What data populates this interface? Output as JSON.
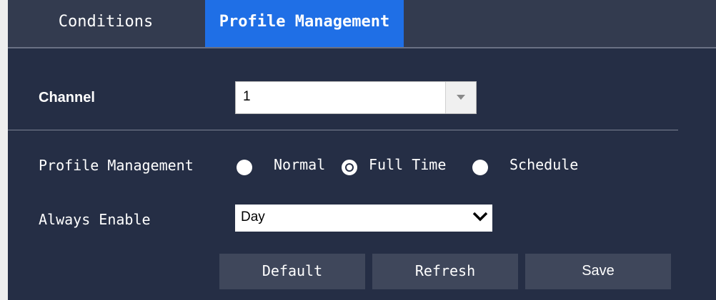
{
  "tabs": {
    "conditions": "Conditions",
    "profile_management": "Profile Management"
  },
  "channel": {
    "label": "Channel",
    "value": "1"
  },
  "profile_management": {
    "label": "Profile Management",
    "options": [
      "Normal",
      "Full Time",
      "Schedule"
    ],
    "selected": "Full Time"
  },
  "always_enable": {
    "label": "Always Enable",
    "value": "Day"
  },
  "buttons": {
    "default": "Default",
    "refresh": "Refresh",
    "save": "Save"
  },
  "colors": {
    "panel_bg": "#252e45",
    "tabbar_bg": "#333b4f",
    "active_tab": "#1f6fe6",
    "button_bg": "#3f475b"
  },
  "icons": {
    "channel_dropdown": "triangle-down-icon",
    "always_dropdown": "chevron-down-icon"
  }
}
